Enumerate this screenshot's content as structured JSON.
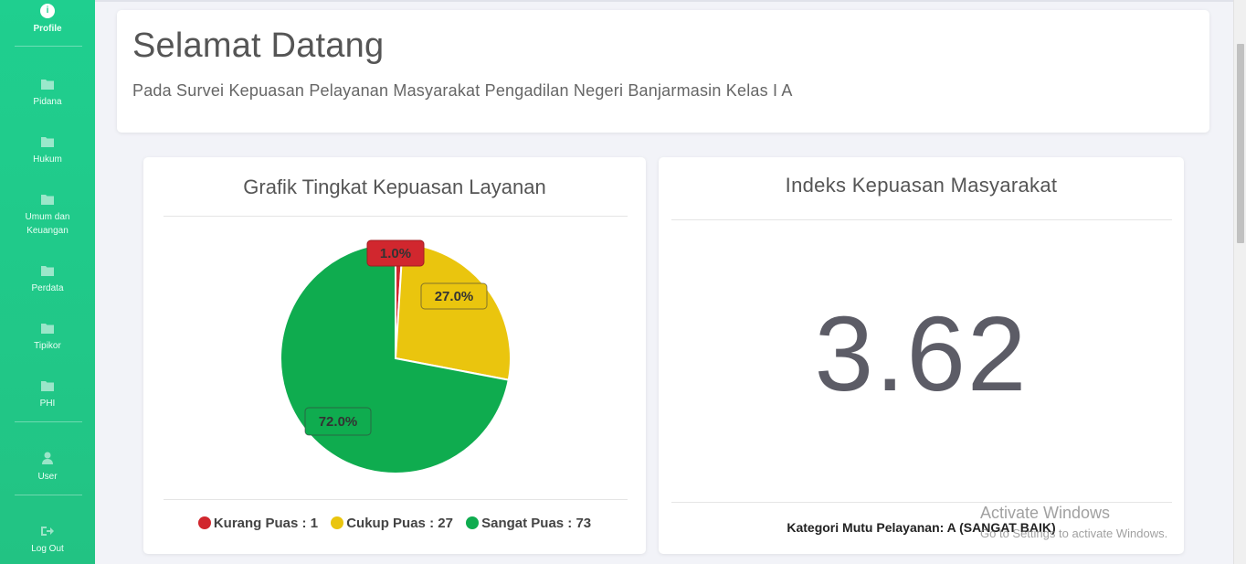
{
  "sidebar": {
    "items": [
      {
        "id": "profile",
        "label": "Profile"
      },
      {
        "id": "pidana",
        "label": "Pidana"
      },
      {
        "id": "hukum",
        "label": "Hukum"
      },
      {
        "id": "umum",
        "label": "Umum dan Keuangan"
      },
      {
        "id": "perdata",
        "label": "Perdata"
      },
      {
        "id": "tipikor",
        "label": "Tipikor"
      },
      {
        "id": "phi",
        "label": "PHI"
      },
      {
        "id": "user",
        "label": "User"
      },
      {
        "id": "logout",
        "label": "Log Out"
      }
    ],
    "icons": {
      "profile": "info-icon",
      "folder": "folder-icon",
      "user": "user-icon",
      "logout": "sign-out-icon"
    }
  },
  "welcome": {
    "title": "Selamat Datang",
    "subtitle": "Pada Survei Kepuasan Pelayanan Masyarakat Pengadilan Negeri Banjarmasin Kelas I A"
  },
  "chart_card": {
    "title": "Grafik Tingkat Kepuasan Layanan",
    "legend": [
      {
        "label": "Kurang Puas : 1",
        "color": "#d1272e"
      },
      {
        "label": "Cukup Puas : 27",
        "color": "#eac50e"
      },
      {
        "label": "Sangat Puas : 73",
        "color": "#0fac4f"
      }
    ]
  },
  "chart_data": {
    "type": "pie",
    "title": "Grafik Tingkat Kepuasan Layanan",
    "slices": [
      {
        "name": "Kurang Puas",
        "value": 1,
        "label": "1.0%",
        "color": "#d1272e"
      },
      {
        "name": "Cukup Puas",
        "value": 27,
        "label": "27.0%",
        "color": "#eac50e"
      },
      {
        "name": "Sangat Puas",
        "value": 72,
        "label": "72.0%",
        "color": "#0fac4f"
      }
    ],
    "legend": [
      "Kurang Puas : 1",
      "Cukup Puas : 27",
      "Sangat Puas : 73"
    ],
    "legend_position": "bottom"
  },
  "index_card": {
    "title": "Indeks Kepuasan Masyarakat",
    "value": "3.62",
    "footer": "Kategori Mutu Pelayanan: A (SANGAT BAIK)"
  },
  "watermark": {
    "line1": "Activate Windows",
    "line2": "Go to Settings to activate Windows."
  }
}
